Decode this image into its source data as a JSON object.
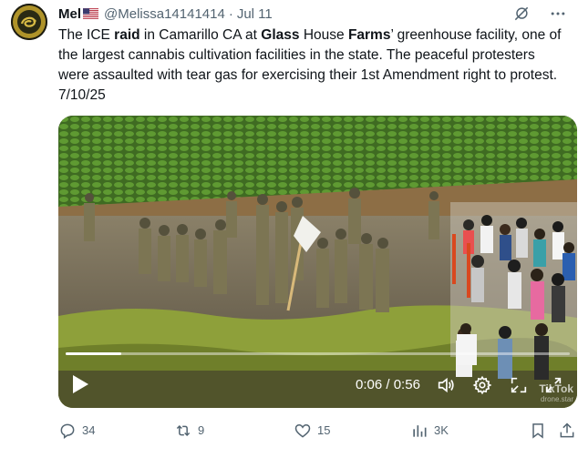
{
  "author": {
    "name": "Mel",
    "flag_icon": "us-flag-icon",
    "handle": "@Melissa14141414",
    "separator": "·",
    "date": "Jul 11",
    "avatar_text_top": "DON'T TREAD",
    "avatar_text_bottom": "ON ME"
  },
  "tweet": {
    "seg1": "The ICE ",
    "seg2": "raid",
    "seg3": " in Camarillo CA at ",
    "seg4": "Glass",
    "seg5": " House ",
    "seg6": "Farms",
    "seg7": "’ greenhouse facility, one of the largest cannabis cultivation facilities in the state. The peaceful protesters were assaulted with tear gas for exercising their 1st Amendment right to protest. 7/10/25"
  },
  "video": {
    "current_time": "0:06",
    "time_sep": " / ",
    "duration": "0:56",
    "progress": 0.11,
    "watermark": "TikTok",
    "watermark_sub": "drone.star"
  },
  "actions": {
    "replies": "34",
    "reposts": "9",
    "likes": "15",
    "views": "3K"
  },
  "colors": {
    "text": "#0f1419",
    "muted": "#536471"
  }
}
